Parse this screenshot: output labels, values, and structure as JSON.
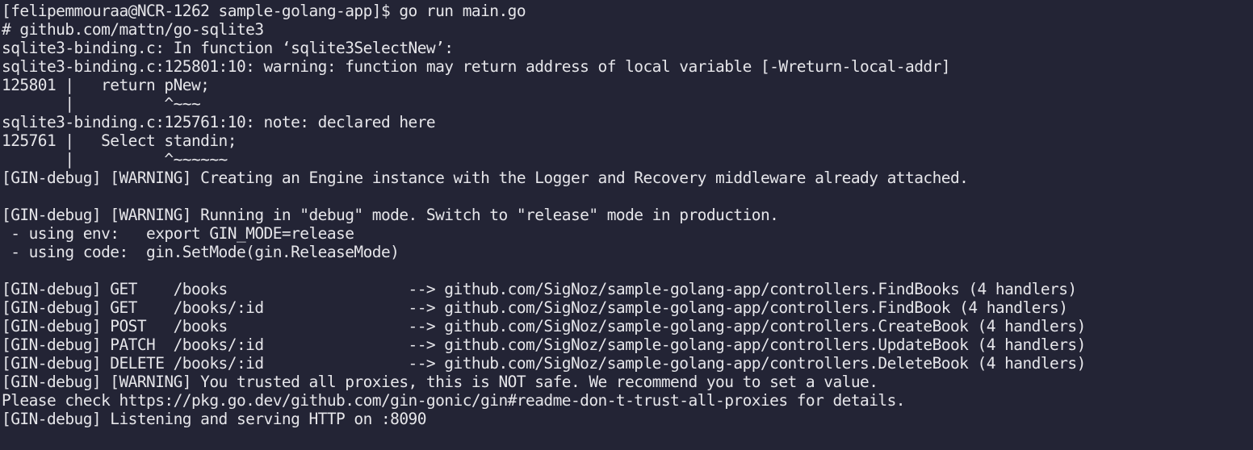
{
  "terminal": {
    "lines": [
      "[felipemmouraa@NCR-1262 sample-golang-app]$ go run main.go",
      "# github.com/mattn/go-sqlite3",
      "sqlite3-binding.c: In function ‘sqlite3SelectNew’:",
      "sqlite3-binding.c:125801:10: warning: function may return address of local variable [-Wreturn-local-addr]",
      "125801 |   return pNew;",
      "       |          ^~~~",
      "sqlite3-binding.c:125761:10: note: declared here",
      "125761 |   Select standin;",
      "       |          ^~~~~~~",
      "[GIN-debug] [WARNING] Creating an Engine instance with the Logger and Recovery middleware already attached.",
      "",
      "[GIN-debug] [WARNING] Running in \"debug\" mode. Switch to \"release\" mode in production.",
      " - using env:   export GIN_MODE=release",
      " - using code:  gin.SetMode(gin.ReleaseMode)",
      "",
      "[GIN-debug] GET    /books                    --> github.com/SigNoz/sample-golang-app/controllers.FindBooks (4 handlers)",
      "[GIN-debug] GET    /books/:id                --> github.com/SigNoz/sample-golang-app/controllers.FindBook (4 handlers)",
      "[GIN-debug] POST   /books                    --> github.com/SigNoz/sample-golang-app/controllers.CreateBook (4 handlers)",
      "[GIN-debug] PATCH  /books/:id                --> github.com/SigNoz/sample-golang-app/controllers.UpdateBook (4 handlers)",
      "[GIN-debug] DELETE /books/:id                --> github.com/SigNoz/sample-golang-app/controllers.DeleteBook (4 handlers)",
      "[GIN-debug] [WARNING] You trusted all proxies, this is NOT safe. We recommend you to set a value.",
      "Please check https://pkg.go.dev/github.com/gin-gonic/gin#readme-don-t-trust-all-proxies for details.",
      "[GIN-debug] Listening and serving HTTP on :8090"
    ]
  }
}
